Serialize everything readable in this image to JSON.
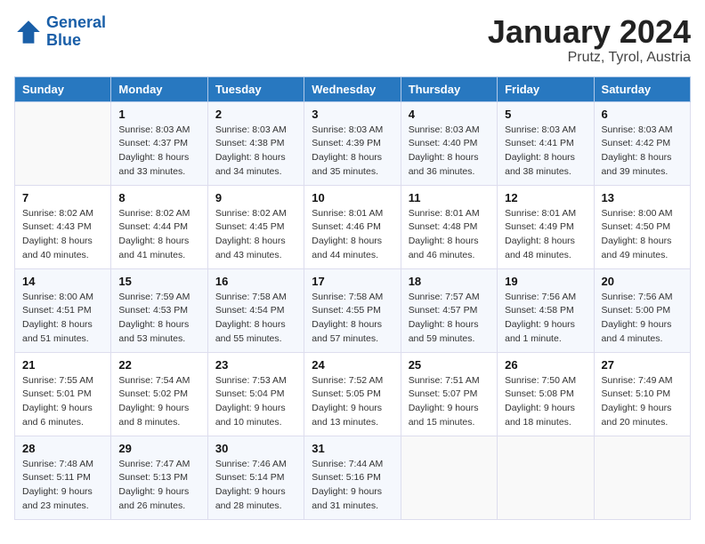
{
  "header": {
    "logo_line1": "General",
    "logo_line2": "Blue",
    "month": "January 2024",
    "location": "Prutz, Tyrol, Austria"
  },
  "weekdays": [
    "Sunday",
    "Monday",
    "Tuesday",
    "Wednesday",
    "Thursday",
    "Friday",
    "Saturday"
  ],
  "weeks": [
    [
      {
        "day": "",
        "info": ""
      },
      {
        "day": "1",
        "info": "Sunrise: 8:03 AM\nSunset: 4:37 PM\nDaylight: 8 hours\nand 33 minutes."
      },
      {
        "day": "2",
        "info": "Sunrise: 8:03 AM\nSunset: 4:38 PM\nDaylight: 8 hours\nand 34 minutes."
      },
      {
        "day": "3",
        "info": "Sunrise: 8:03 AM\nSunset: 4:39 PM\nDaylight: 8 hours\nand 35 minutes."
      },
      {
        "day": "4",
        "info": "Sunrise: 8:03 AM\nSunset: 4:40 PM\nDaylight: 8 hours\nand 36 minutes."
      },
      {
        "day": "5",
        "info": "Sunrise: 8:03 AM\nSunset: 4:41 PM\nDaylight: 8 hours\nand 38 minutes."
      },
      {
        "day": "6",
        "info": "Sunrise: 8:03 AM\nSunset: 4:42 PM\nDaylight: 8 hours\nand 39 minutes."
      }
    ],
    [
      {
        "day": "7",
        "info": "Sunrise: 8:02 AM\nSunset: 4:43 PM\nDaylight: 8 hours\nand 40 minutes."
      },
      {
        "day": "8",
        "info": "Sunrise: 8:02 AM\nSunset: 4:44 PM\nDaylight: 8 hours\nand 41 minutes."
      },
      {
        "day": "9",
        "info": "Sunrise: 8:02 AM\nSunset: 4:45 PM\nDaylight: 8 hours\nand 43 minutes."
      },
      {
        "day": "10",
        "info": "Sunrise: 8:01 AM\nSunset: 4:46 PM\nDaylight: 8 hours\nand 44 minutes."
      },
      {
        "day": "11",
        "info": "Sunrise: 8:01 AM\nSunset: 4:48 PM\nDaylight: 8 hours\nand 46 minutes."
      },
      {
        "day": "12",
        "info": "Sunrise: 8:01 AM\nSunset: 4:49 PM\nDaylight: 8 hours\nand 48 minutes."
      },
      {
        "day": "13",
        "info": "Sunrise: 8:00 AM\nSunset: 4:50 PM\nDaylight: 8 hours\nand 49 minutes."
      }
    ],
    [
      {
        "day": "14",
        "info": "Sunrise: 8:00 AM\nSunset: 4:51 PM\nDaylight: 8 hours\nand 51 minutes."
      },
      {
        "day": "15",
        "info": "Sunrise: 7:59 AM\nSunset: 4:53 PM\nDaylight: 8 hours\nand 53 minutes."
      },
      {
        "day": "16",
        "info": "Sunrise: 7:58 AM\nSunset: 4:54 PM\nDaylight: 8 hours\nand 55 minutes."
      },
      {
        "day": "17",
        "info": "Sunrise: 7:58 AM\nSunset: 4:55 PM\nDaylight: 8 hours\nand 57 minutes."
      },
      {
        "day": "18",
        "info": "Sunrise: 7:57 AM\nSunset: 4:57 PM\nDaylight: 8 hours\nand 59 minutes."
      },
      {
        "day": "19",
        "info": "Sunrise: 7:56 AM\nSunset: 4:58 PM\nDaylight: 9 hours\nand 1 minute."
      },
      {
        "day": "20",
        "info": "Sunrise: 7:56 AM\nSunset: 5:00 PM\nDaylight: 9 hours\nand 4 minutes."
      }
    ],
    [
      {
        "day": "21",
        "info": "Sunrise: 7:55 AM\nSunset: 5:01 PM\nDaylight: 9 hours\nand 6 minutes."
      },
      {
        "day": "22",
        "info": "Sunrise: 7:54 AM\nSunset: 5:02 PM\nDaylight: 9 hours\nand 8 minutes."
      },
      {
        "day": "23",
        "info": "Sunrise: 7:53 AM\nSunset: 5:04 PM\nDaylight: 9 hours\nand 10 minutes."
      },
      {
        "day": "24",
        "info": "Sunrise: 7:52 AM\nSunset: 5:05 PM\nDaylight: 9 hours\nand 13 minutes."
      },
      {
        "day": "25",
        "info": "Sunrise: 7:51 AM\nSunset: 5:07 PM\nDaylight: 9 hours\nand 15 minutes."
      },
      {
        "day": "26",
        "info": "Sunrise: 7:50 AM\nSunset: 5:08 PM\nDaylight: 9 hours\nand 18 minutes."
      },
      {
        "day": "27",
        "info": "Sunrise: 7:49 AM\nSunset: 5:10 PM\nDaylight: 9 hours\nand 20 minutes."
      }
    ],
    [
      {
        "day": "28",
        "info": "Sunrise: 7:48 AM\nSunset: 5:11 PM\nDaylight: 9 hours\nand 23 minutes."
      },
      {
        "day": "29",
        "info": "Sunrise: 7:47 AM\nSunset: 5:13 PM\nDaylight: 9 hours\nand 26 minutes."
      },
      {
        "day": "30",
        "info": "Sunrise: 7:46 AM\nSunset: 5:14 PM\nDaylight: 9 hours\nand 28 minutes."
      },
      {
        "day": "31",
        "info": "Sunrise: 7:44 AM\nSunset: 5:16 PM\nDaylight: 9 hours\nand 31 minutes."
      },
      {
        "day": "",
        "info": ""
      },
      {
        "day": "",
        "info": ""
      },
      {
        "day": "",
        "info": ""
      }
    ]
  ]
}
